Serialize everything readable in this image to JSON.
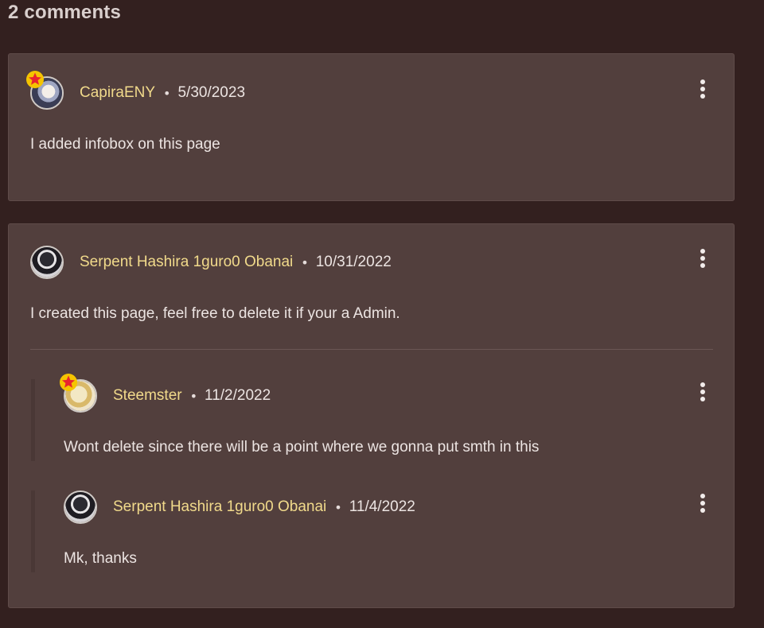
{
  "heading": "2 comments",
  "comments": [
    {
      "author": "CapiraENY",
      "separator": "•",
      "date": "5/30/2023",
      "body": "I added infobox on this page",
      "avatar_icon": "user-avatar",
      "has_badge": true,
      "replies": []
    },
    {
      "author": "Serpent Hashira 1guro0 Obanai",
      "separator": "•",
      "date": "10/31/2022",
      "body": "I created this page, feel free to delete it if your a Admin.",
      "avatar_icon": "user-avatar",
      "has_badge": false,
      "replies": [
        {
          "author": "Steemster",
          "separator": "•",
          "date": "11/2/2022",
          "body": "Wont delete since there will be a point where we gonna put smth in this",
          "avatar_icon": "user-avatar",
          "has_badge": true
        },
        {
          "author": "Serpent Hashira 1guro0 Obanai",
          "separator": "•",
          "date": "11/4/2022",
          "body": "Mk, thanks",
          "avatar_icon": "user-avatar",
          "has_badge": false
        }
      ]
    }
  ],
  "icons": {
    "menu": "more-vertical-icon",
    "badge": "star-badge-icon"
  },
  "colors": {
    "background": "#33201f",
    "card": "#523f3d",
    "author": "#f1da8b",
    "text": "#ece4e2",
    "badge_star": "#e8242f",
    "badge_ring": "#f5c400"
  }
}
